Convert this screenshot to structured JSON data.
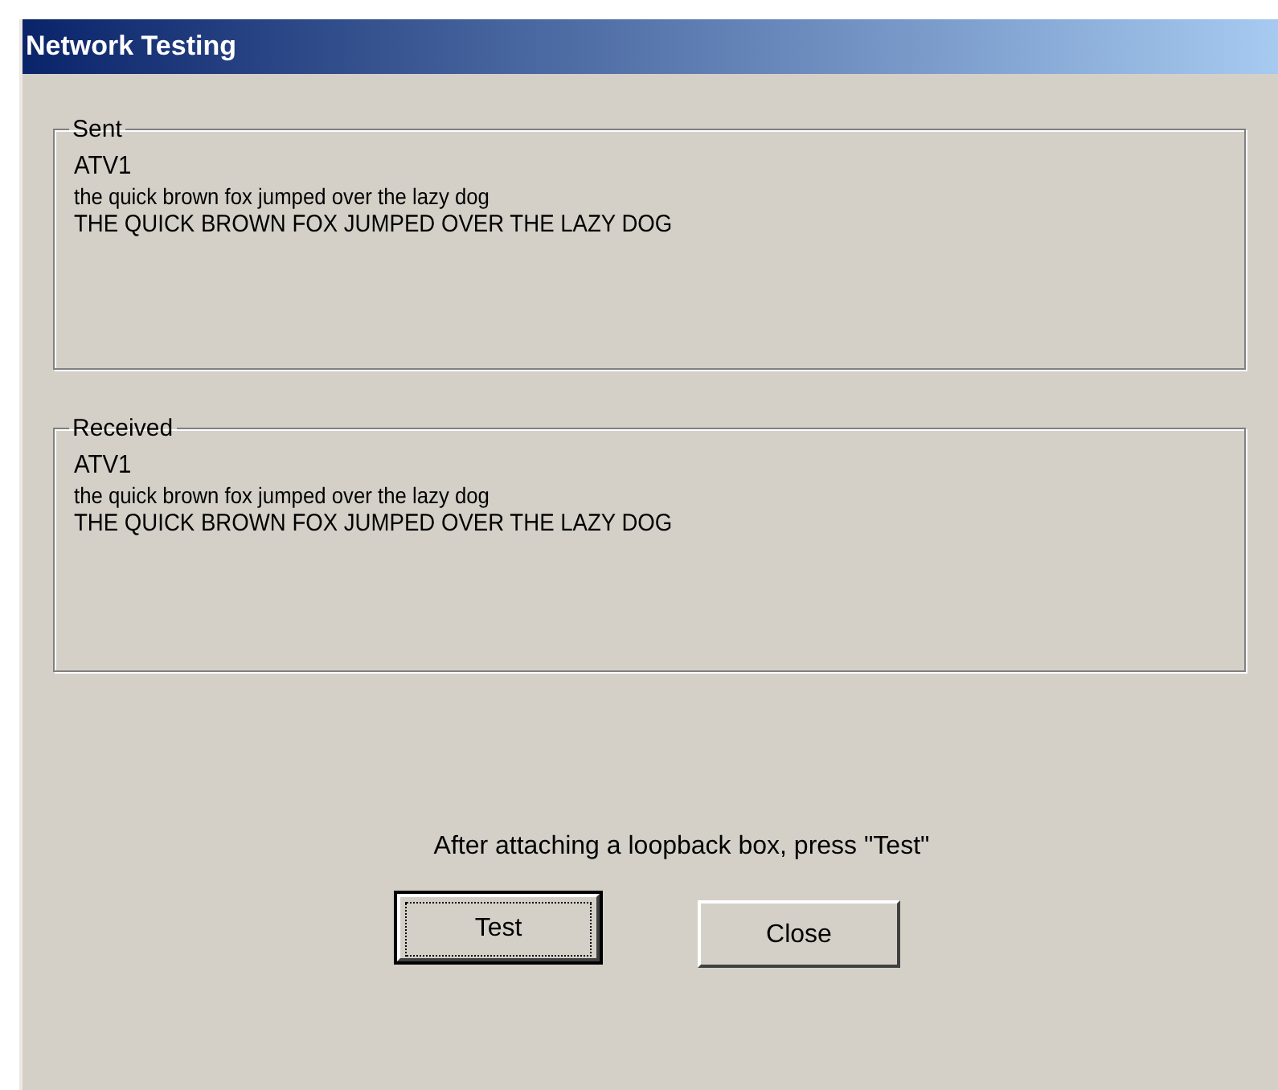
{
  "window": {
    "title": "Network Testing"
  },
  "groups": [
    {
      "label": "Sent",
      "lines": [
        "ATV1",
        "the quick brown fox jumped over the lazy dog",
        "THE QUICK BROWN FOX JUMPED OVER THE LAZY DOG"
      ]
    },
    {
      "label": "Received",
      "lines": [
        "ATV1",
        "the quick brown fox jumped over the lazy dog",
        "THE QUICK BROWN FOX JUMPED OVER THE LAZY DOG"
      ]
    }
  ],
  "instruction": "After attaching a loopback box, press \"Test\"",
  "buttons": [
    {
      "label": "Test",
      "default": true
    },
    {
      "label": "Close",
      "default": false
    }
  ]
}
